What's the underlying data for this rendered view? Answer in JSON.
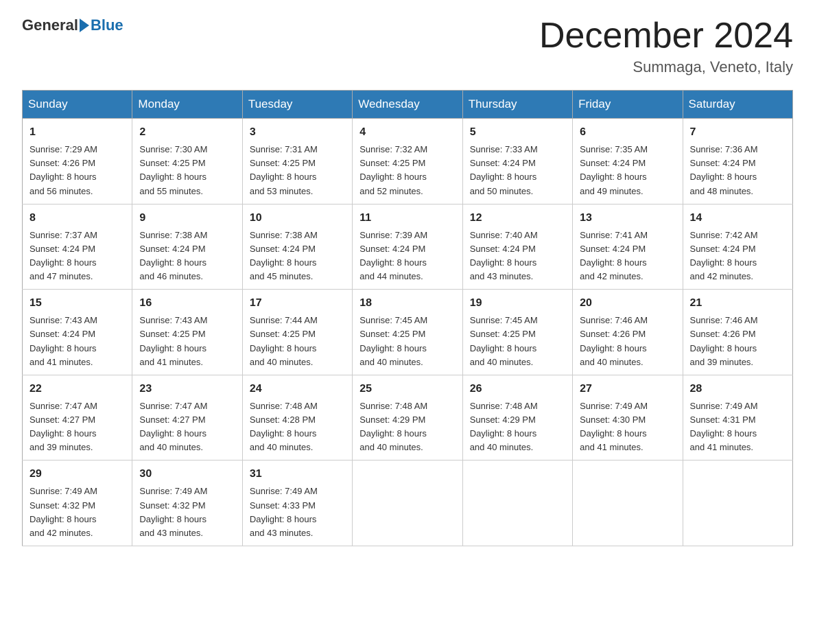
{
  "logo": {
    "general": "General",
    "blue": "Blue"
  },
  "title": "December 2024",
  "location": "Summaga, Veneto, Italy",
  "days_of_week": [
    "Sunday",
    "Monday",
    "Tuesday",
    "Wednesday",
    "Thursday",
    "Friday",
    "Saturday"
  ],
  "weeks": [
    [
      {
        "day": "1",
        "sunrise": "7:29 AM",
        "sunset": "4:26 PM",
        "daylight": "8 hours and 56 minutes."
      },
      {
        "day": "2",
        "sunrise": "7:30 AM",
        "sunset": "4:25 PM",
        "daylight": "8 hours and 55 minutes."
      },
      {
        "day": "3",
        "sunrise": "7:31 AM",
        "sunset": "4:25 PM",
        "daylight": "8 hours and 53 minutes."
      },
      {
        "day": "4",
        "sunrise": "7:32 AM",
        "sunset": "4:25 PM",
        "daylight": "8 hours and 52 minutes."
      },
      {
        "day": "5",
        "sunrise": "7:33 AM",
        "sunset": "4:24 PM",
        "daylight": "8 hours and 50 minutes."
      },
      {
        "day": "6",
        "sunrise": "7:35 AM",
        "sunset": "4:24 PM",
        "daylight": "8 hours and 49 minutes."
      },
      {
        "day": "7",
        "sunrise": "7:36 AM",
        "sunset": "4:24 PM",
        "daylight": "8 hours and 48 minutes."
      }
    ],
    [
      {
        "day": "8",
        "sunrise": "7:37 AM",
        "sunset": "4:24 PM",
        "daylight": "8 hours and 47 minutes."
      },
      {
        "day": "9",
        "sunrise": "7:38 AM",
        "sunset": "4:24 PM",
        "daylight": "8 hours and 46 minutes."
      },
      {
        "day": "10",
        "sunrise": "7:38 AM",
        "sunset": "4:24 PM",
        "daylight": "8 hours and 45 minutes."
      },
      {
        "day": "11",
        "sunrise": "7:39 AM",
        "sunset": "4:24 PM",
        "daylight": "8 hours and 44 minutes."
      },
      {
        "day": "12",
        "sunrise": "7:40 AM",
        "sunset": "4:24 PM",
        "daylight": "8 hours and 43 minutes."
      },
      {
        "day": "13",
        "sunrise": "7:41 AM",
        "sunset": "4:24 PM",
        "daylight": "8 hours and 42 minutes."
      },
      {
        "day": "14",
        "sunrise": "7:42 AM",
        "sunset": "4:24 PM",
        "daylight": "8 hours and 42 minutes."
      }
    ],
    [
      {
        "day": "15",
        "sunrise": "7:43 AM",
        "sunset": "4:24 PM",
        "daylight": "8 hours and 41 minutes."
      },
      {
        "day": "16",
        "sunrise": "7:43 AM",
        "sunset": "4:25 PM",
        "daylight": "8 hours and 41 minutes."
      },
      {
        "day": "17",
        "sunrise": "7:44 AM",
        "sunset": "4:25 PM",
        "daylight": "8 hours and 40 minutes."
      },
      {
        "day": "18",
        "sunrise": "7:45 AM",
        "sunset": "4:25 PM",
        "daylight": "8 hours and 40 minutes."
      },
      {
        "day": "19",
        "sunrise": "7:45 AM",
        "sunset": "4:25 PM",
        "daylight": "8 hours and 40 minutes."
      },
      {
        "day": "20",
        "sunrise": "7:46 AM",
        "sunset": "4:26 PM",
        "daylight": "8 hours and 40 minutes."
      },
      {
        "day": "21",
        "sunrise": "7:46 AM",
        "sunset": "4:26 PM",
        "daylight": "8 hours and 39 minutes."
      }
    ],
    [
      {
        "day": "22",
        "sunrise": "7:47 AM",
        "sunset": "4:27 PM",
        "daylight": "8 hours and 39 minutes."
      },
      {
        "day": "23",
        "sunrise": "7:47 AM",
        "sunset": "4:27 PM",
        "daylight": "8 hours and 40 minutes."
      },
      {
        "day": "24",
        "sunrise": "7:48 AM",
        "sunset": "4:28 PM",
        "daylight": "8 hours and 40 minutes."
      },
      {
        "day": "25",
        "sunrise": "7:48 AM",
        "sunset": "4:29 PM",
        "daylight": "8 hours and 40 minutes."
      },
      {
        "day": "26",
        "sunrise": "7:48 AM",
        "sunset": "4:29 PM",
        "daylight": "8 hours and 40 minutes."
      },
      {
        "day": "27",
        "sunrise": "7:49 AM",
        "sunset": "4:30 PM",
        "daylight": "8 hours and 41 minutes."
      },
      {
        "day": "28",
        "sunrise": "7:49 AM",
        "sunset": "4:31 PM",
        "daylight": "8 hours and 41 minutes."
      }
    ],
    [
      {
        "day": "29",
        "sunrise": "7:49 AM",
        "sunset": "4:32 PM",
        "daylight": "8 hours and 42 minutes."
      },
      {
        "day": "30",
        "sunrise": "7:49 AM",
        "sunset": "4:32 PM",
        "daylight": "8 hours and 43 minutes."
      },
      {
        "day": "31",
        "sunrise": "7:49 AM",
        "sunset": "4:33 PM",
        "daylight": "8 hours and 43 minutes."
      },
      null,
      null,
      null,
      null
    ]
  ],
  "labels": {
    "sunrise": "Sunrise:",
    "sunset": "Sunset:",
    "daylight": "Daylight:"
  }
}
